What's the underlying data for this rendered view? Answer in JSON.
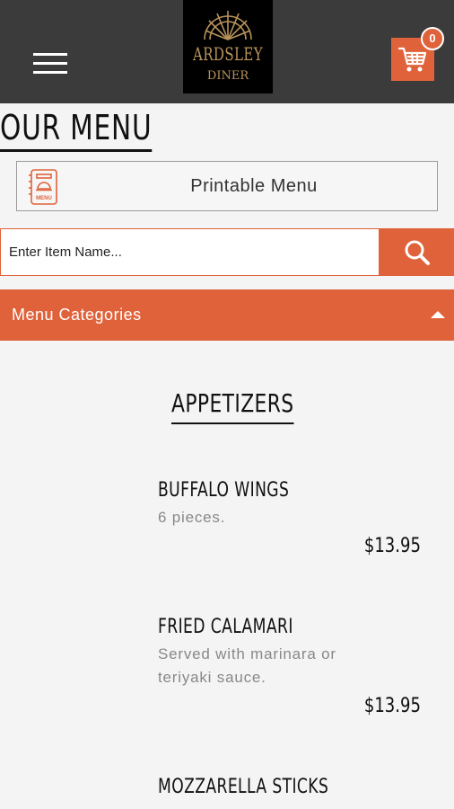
{
  "header": {
    "logo": {
      "line1": "ARDSLEY",
      "line2": "DINER"
    },
    "cart_count": "0"
  },
  "page_title": "OUR MENU",
  "printable_menu": {
    "label": "Printable Menu",
    "icon_text": "MENU"
  },
  "search": {
    "placeholder": "Enter Item Name..."
  },
  "categories": {
    "label": "Menu Categories"
  },
  "section": {
    "title": "APPETIZERS",
    "items": [
      {
        "name": "BUFFALO WINGS",
        "description": "6 pieces.",
        "price": "$13.95"
      },
      {
        "name": "FRIED CALAMARI",
        "description": "Served with marinara or teriyaki sauce.",
        "price": "$13.95"
      },
      {
        "name": "MOZZARELLA STICKS",
        "description": "",
        "price": ""
      }
    ]
  },
  "colors": {
    "accent": "#e0623a",
    "header_bg": "#3b3b3b",
    "logo_gold": "#b9935a"
  },
  "icons": [
    "menu-icon",
    "cart-icon",
    "printable-menu-icon",
    "search-icon",
    "caret-up-icon"
  ]
}
